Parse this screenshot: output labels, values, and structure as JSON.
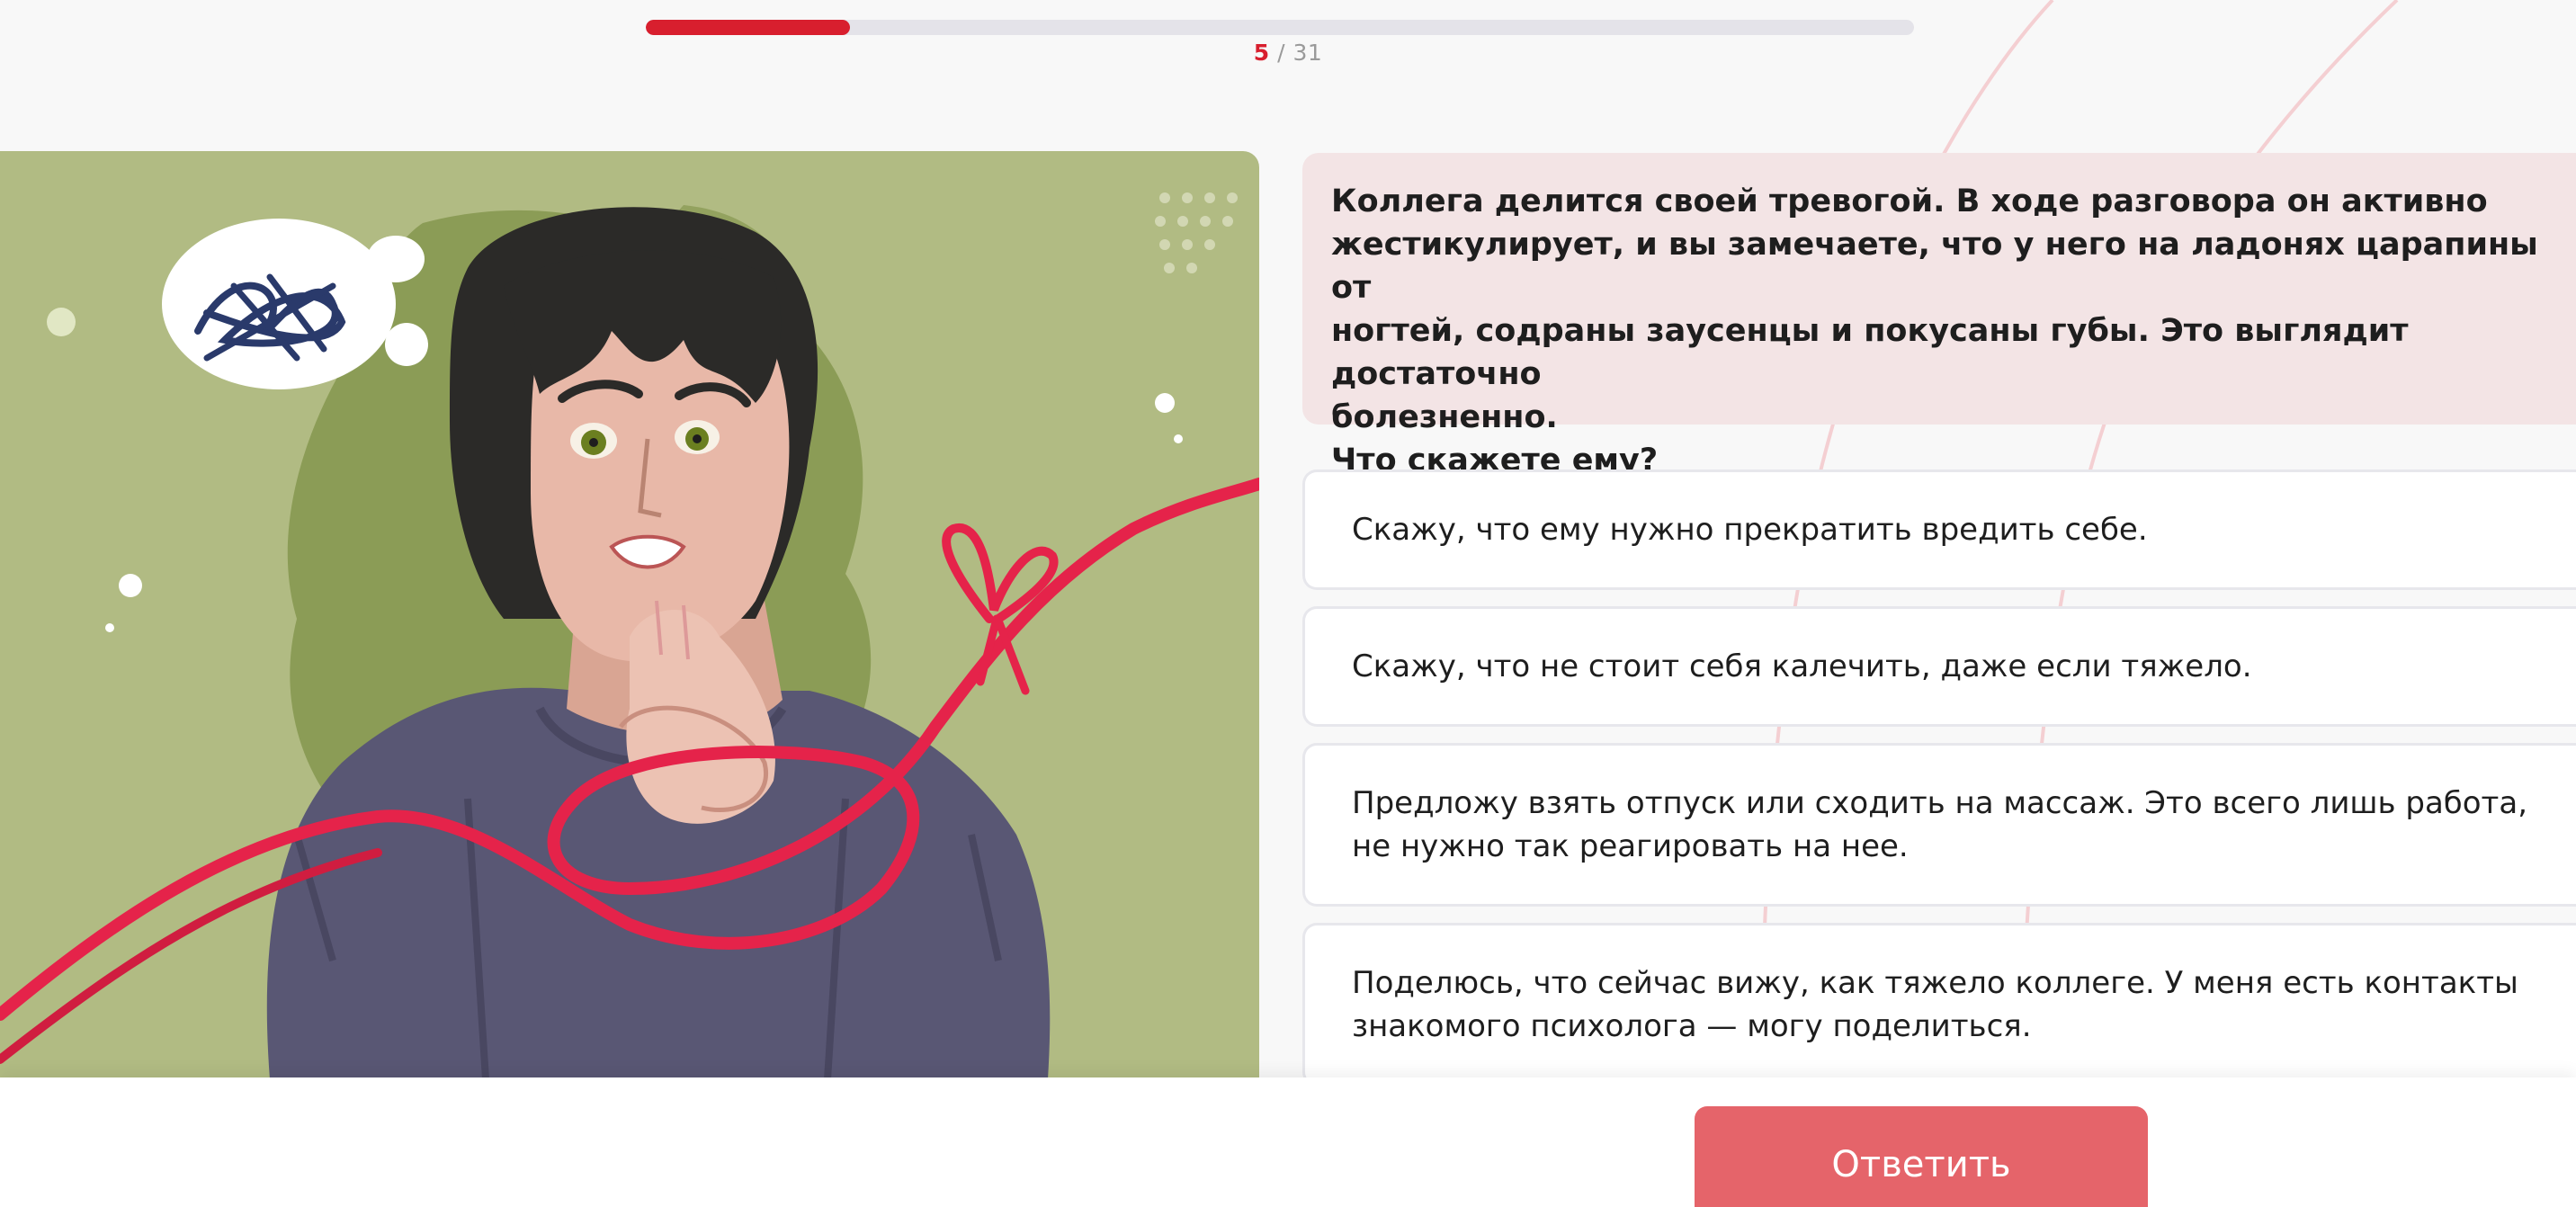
{
  "colors": {
    "accent": "#d81f2e",
    "button": "#e5646a",
    "question_bg": "#f3e4e5",
    "illustration_bg": "#b1bb83"
  },
  "progress": {
    "current": "5",
    "separator": " / ",
    "total": "31",
    "fraction": 0.161
  },
  "illustration": {
    "icon": "anxious-person-illustration"
  },
  "question": {
    "text": "Коллега делится своей тревогой. В ходе разговора он активно\nжестикулирует, и вы замечаете, что у него на ладонях царапины от\nногтей, содраны заусенцы и покусаны губы. Это выглядит достаточно\nболезненно.\nЧто скажете ему?"
  },
  "answers": [
    {
      "label": "Скажу, что ему нужно прекратить вредить себе."
    },
    {
      "label": "Скажу, что не стоит себя калечить, даже если тяжело."
    },
    {
      "label": "Предложу взять отпуск или сходить на массаж. Это всего лишь работа,\nне нужно так реагировать на нее."
    },
    {
      "label": "Поделюсь, что сейчас вижу, как тяжело коллеге. У меня есть контакты\nзнакомого психолога — могу поделиться."
    }
  ],
  "footer": {
    "submit_label": "Ответить"
  }
}
